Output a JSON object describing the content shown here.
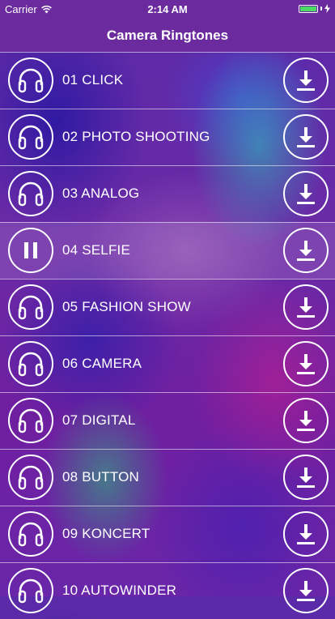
{
  "status_bar": {
    "carrier": "Carrier",
    "time": "2:14 AM",
    "wifi_icon": "wifi-icon",
    "battery_icon": "battery-icon",
    "charging_icon": "charging-icon",
    "battery_color": "#4cd964"
  },
  "nav": {
    "title": "Camera Ringtones"
  },
  "colors": {
    "bar": "#6b2a9e"
  },
  "ringtones": [
    {
      "label": "01 CLICK",
      "state_icon": "headphones-icon",
      "action_icon": "download-icon"
    },
    {
      "label": "02 PHOTO SHOOTING",
      "state_icon": "headphones-icon",
      "action_icon": "download-icon"
    },
    {
      "label": "03 ANALOG",
      "state_icon": "headphones-icon",
      "action_icon": "download-icon"
    },
    {
      "label": "04 SELFIE",
      "state_icon": "pause-icon",
      "action_icon": "download-icon"
    },
    {
      "label": "05 FASHION SHOW",
      "state_icon": "headphones-icon",
      "action_icon": "download-icon"
    },
    {
      "label": "06 CAMERA",
      "state_icon": "headphones-icon",
      "action_icon": "download-icon"
    },
    {
      "label": "07 DIGITAL",
      "state_icon": "headphones-icon",
      "action_icon": "download-icon"
    },
    {
      "label": "08 BUTTON",
      "state_icon": "headphones-icon",
      "action_icon": "download-icon"
    },
    {
      "label": "09 KONCERT",
      "state_icon": "headphones-icon",
      "action_icon": "download-icon"
    },
    {
      "label": "10 AUTOWINDER",
      "state_icon": "headphones-icon",
      "action_icon": "download-icon"
    }
  ]
}
